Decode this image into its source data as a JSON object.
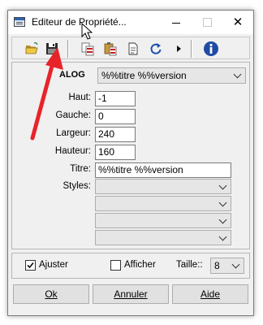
{
  "window": {
    "title": "Editeur de Propriété..."
  },
  "toolbar": {
    "icons": [
      "open-folder-icon",
      "save-icon",
      "copy-icon",
      "paste-icon",
      "page-icon",
      "refresh-icon",
      "play-icon",
      "info-icon"
    ]
  },
  "header": {
    "type_label": "ALOG",
    "object_value": "%%titre %%version"
  },
  "fields": [
    {
      "label": "Haut:",
      "value": "-1"
    },
    {
      "label": "Gauche:",
      "value": "0"
    },
    {
      "label": "Largeur:",
      "value": "240"
    },
    {
      "label": "Hauteur:",
      "value": "160"
    }
  ],
  "titre": {
    "label": "Titre:",
    "value": "%%titre %%version"
  },
  "styles": {
    "label": "Styles:"
  },
  "options": {
    "ajuster_label": "Ajuster",
    "ajuster_checked": true,
    "afficher_label": "Afficher",
    "afficher_checked": false,
    "taille_label": "Taille::",
    "taille_value": "8"
  },
  "buttons": {
    "ok": "Ok",
    "annuler": "Annuler",
    "aide": "Aide"
  },
  "colors": {
    "arrow": "#e8232a",
    "info": "#1f4ba6",
    "refresh": "#1e4fb0"
  }
}
